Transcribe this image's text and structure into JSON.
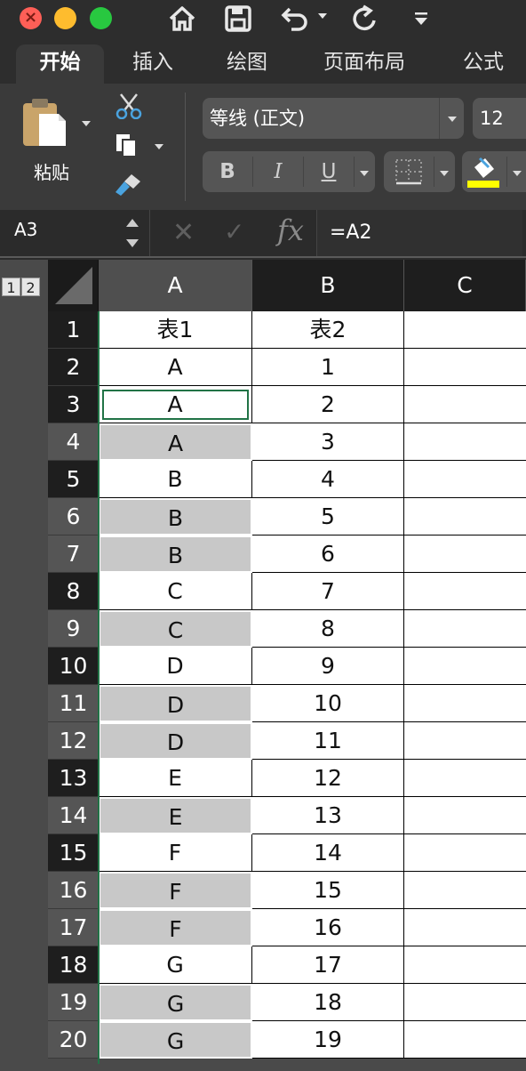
{
  "toolbar": {
    "tabs": [
      "开始",
      "插入",
      "绘图",
      "页面布局",
      "公式"
    ],
    "paste_label": "粘贴",
    "font_name": "等线 (正文)",
    "font_size": "12",
    "bold": "B",
    "italic": "I",
    "underline": "U",
    "fill_color": "#ffff00"
  },
  "formula_bar": {
    "name_box": "A3",
    "fx": "fx",
    "formula": "=A2"
  },
  "sheet": {
    "outline_levels": [
      "1",
      "2"
    ],
    "columns": [
      "A",
      "B",
      "C"
    ],
    "active_cell": "A3",
    "rows": [
      {
        "num": "1",
        "a": "表1",
        "b": "表2",
        "gray": false
      },
      {
        "num": "2",
        "a": "A",
        "b": "1",
        "gray": false
      },
      {
        "num": "3",
        "a": "A",
        "b": "2",
        "gray": false
      },
      {
        "num": "4",
        "a": "A",
        "b": "3",
        "gray": true
      },
      {
        "num": "5",
        "a": "B",
        "b": "4",
        "gray": false
      },
      {
        "num": "6",
        "a": "B",
        "b": "5",
        "gray": true
      },
      {
        "num": "7",
        "a": "B",
        "b": "6",
        "gray": true
      },
      {
        "num": "8",
        "a": "C",
        "b": "7",
        "gray": false
      },
      {
        "num": "9",
        "a": "C",
        "b": "8",
        "gray": true
      },
      {
        "num": "10",
        "a": "D",
        "b": "9",
        "gray": false
      },
      {
        "num": "11",
        "a": "D",
        "b": "10",
        "gray": true
      },
      {
        "num": "12",
        "a": "D",
        "b": "11",
        "gray": true
      },
      {
        "num": "13",
        "a": "E",
        "b": "12",
        "gray": false
      },
      {
        "num": "14",
        "a": "E",
        "b": "13",
        "gray": true
      },
      {
        "num": "15",
        "a": "F",
        "b": "14",
        "gray": false
      },
      {
        "num": "16",
        "a": "F",
        "b": "15",
        "gray": true
      },
      {
        "num": "17",
        "a": "F",
        "b": "16",
        "gray": true
      },
      {
        "num": "18",
        "a": "G",
        "b": "17",
        "gray": false
      },
      {
        "num": "19",
        "a": "G",
        "b": "18",
        "gray": true
      },
      {
        "num": "20",
        "a": "G",
        "b": "19",
        "gray": true
      }
    ]
  }
}
